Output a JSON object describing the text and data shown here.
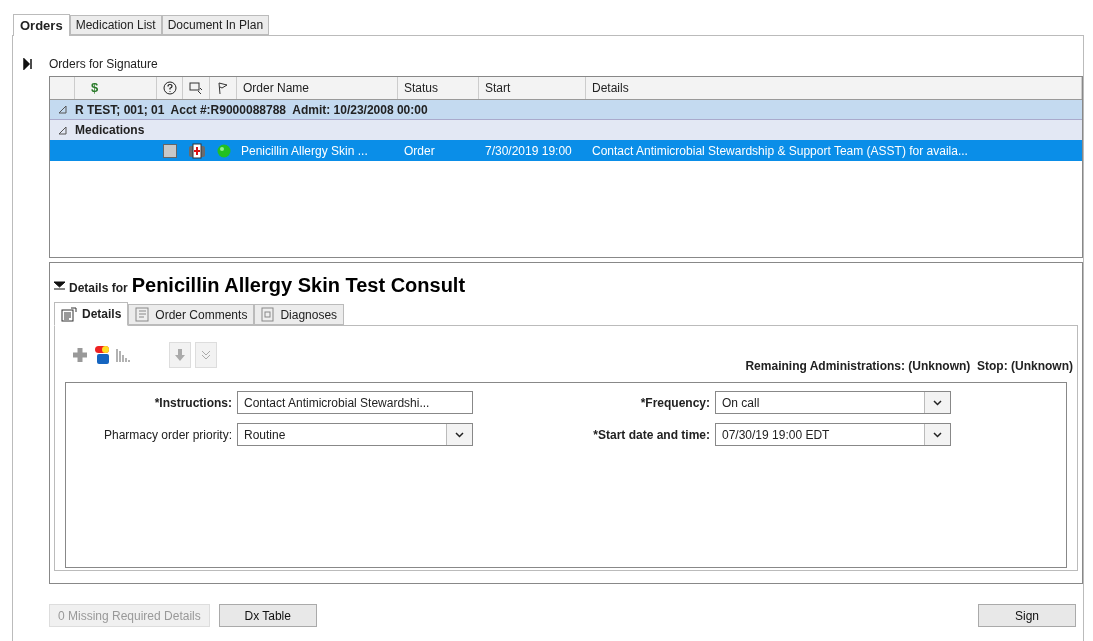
{
  "tabs": [
    {
      "label": "Orders",
      "selected": true
    },
    {
      "label": "Medication List",
      "selected": false
    },
    {
      "label": "Document In Plan",
      "selected": false
    }
  ],
  "panel": {
    "title": "Orders for Signature",
    "collapsed": true
  },
  "table": {
    "columns": [
      {
        "kind": "blank"
      },
      {
        "kind": "text",
        "label": "$"
      },
      {
        "kind": "help"
      },
      {
        "kind": "note"
      },
      {
        "kind": "flag"
      },
      {
        "kind": "text",
        "label": "Order Name"
      },
      {
        "kind": "text",
        "label": "Status"
      },
      {
        "kind": "text",
        "label": "Start"
      },
      {
        "kind": "text",
        "label": "Details"
      }
    ],
    "groups": [
      {
        "kind": "patient",
        "label": "R TEST; 001; 01  Acct #:R9000088788  Admit: 10/23/2008 00:00",
        "expanded": true,
        "children": [
          {
            "kind": "category",
            "label": "Medications",
            "expanded": true,
            "rows": [
              {
                "selected": true,
                "checked": false,
                "name": "Penicillin Allergy Skin ...",
                "status": "Order",
                "start": "7/30/2019 19:00",
                "details": "Contact Antimicrobial Stewardship & Support Team (ASST) for availa..."
              }
            ]
          }
        ]
      }
    ]
  },
  "details": {
    "expanded": true,
    "prefix": "Details for",
    "title": "Penicillin Allergy Skin Test Consult",
    "tabs": [
      {
        "label": "Details",
        "selected": true,
        "kind": "form"
      },
      {
        "label": "Order Comments",
        "selected": false,
        "kind": "comments"
      },
      {
        "label": "Diagnoses",
        "selected": false,
        "kind": "diagnoses"
      }
    ],
    "summary": "Remaining Administrations: (Unknown)  Stop: (Unknown)",
    "fields": [
      {
        "label": "*Instructions:",
        "value": "Contact Antimicrobial Stewardshi...",
        "kind": "text",
        "required": true
      },
      {
        "label": "*Frequency:",
        "value": "On call",
        "kind": "dropdown",
        "required": true
      },
      {
        "label": "Pharmacy order priority:",
        "value": "Routine",
        "kind": "dropdown",
        "required": false
      },
      {
        "label": "*Start date and time:",
        "value": "07/30/19 19:00 EDT",
        "kind": "dropdown",
        "required": true
      }
    ]
  },
  "buttons": [
    {
      "label": "0 Missing Required Details",
      "disabled": true
    },
    {
      "label": "Dx Table",
      "disabled": false
    },
    {
      "label": "Sign",
      "disabled": false
    }
  ]
}
